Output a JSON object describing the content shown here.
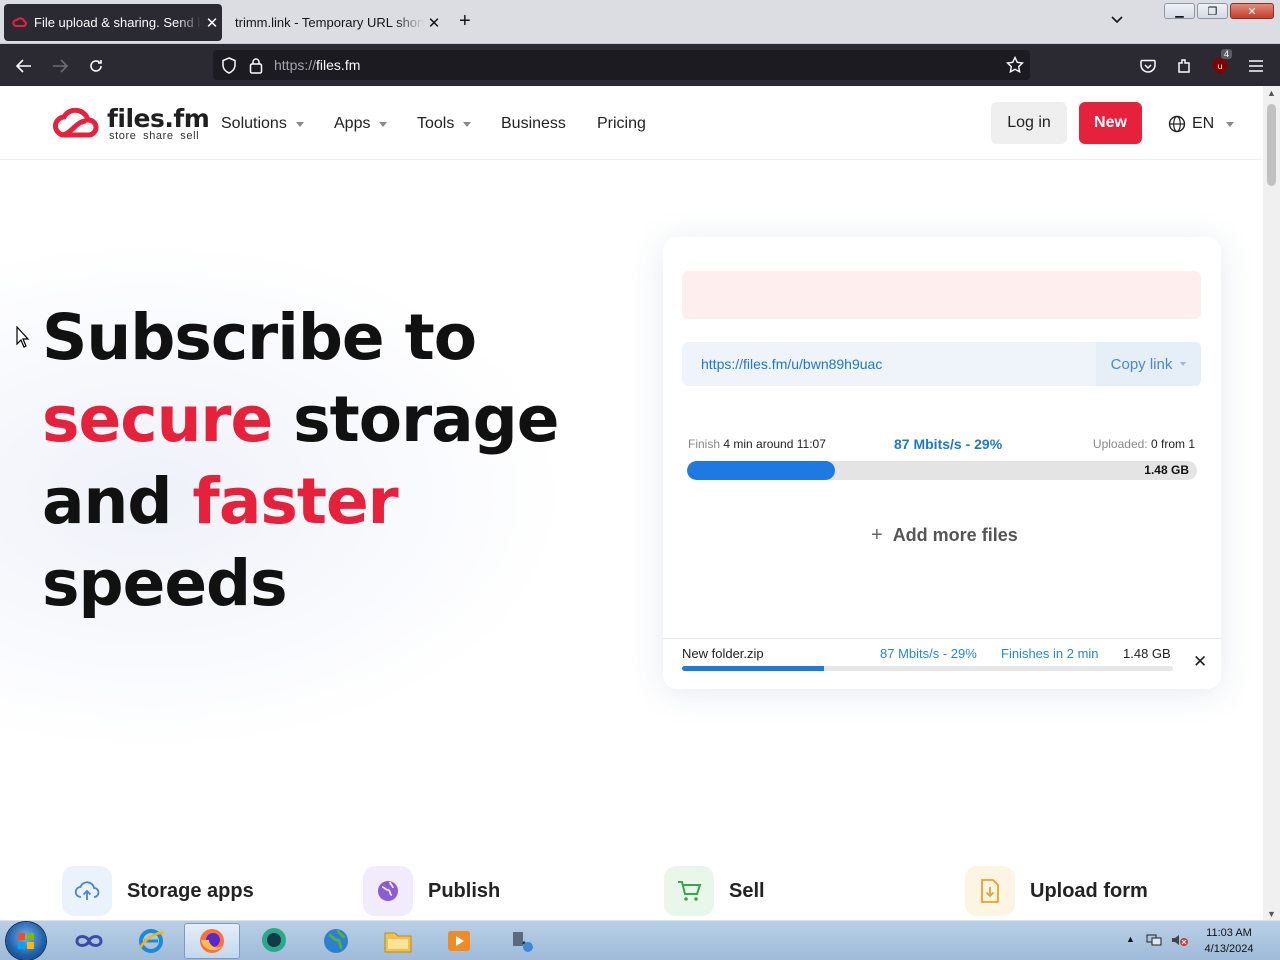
{
  "browser": {
    "tabs": [
      {
        "title": "File upload & sharing. Send large files",
        "active": true
      },
      {
        "title": "trimm.link - Temporary URL shortener",
        "active": false
      }
    ],
    "url_protocol": "https://",
    "url_host": "files.fm",
    "extension_badge": "4"
  },
  "site": {
    "brand": "files.fm",
    "tagline": "store share sell",
    "nav": [
      {
        "label": "Solutions",
        "dropdown": true
      },
      {
        "label": "Apps",
        "dropdown": true
      },
      {
        "label": "Tools",
        "dropdown": true
      },
      {
        "label": "Business",
        "dropdown": false
      },
      {
        "label": "Pricing",
        "dropdown": false
      }
    ],
    "login_label": "Log in",
    "new_label": "New",
    "lang_label": "EN"
  },
  "hero": {
    "line1": "Subscribe to",
    "line2_red": "secure",
    "line2_rest": " storage",
    "line3_start": "and ",
    "line3_red": "faster",
    "line4": "speeds"
  },
  "upload": {
    "link_url": "https://files.fm/u/bwn89h9uac",
    "copy_label": "Copy link",
    "finish_label": "Finish",
    "finish_value": "4 min around 11:07",
    "speed": "87 Mbits/s - 29%",
    "uploaded_label": "Uploaded:",
    "uploaded_value": "0 from 1",
    "total_size": "1.48 GB",
    "progress_fraction": 0.29,
    "add_more_label": "Add more files",
    "file": {
      "name": "New folder.zip",
      "speed": "87 Mbits/s - 29%",
      "finishes": "Finishes in 2 min",
      "size": "1.48 GB",
      "progress_fraction": 0.29
    }
  },
  "features": [
    {
      "label": "Storage apps",
      "icon": "cloud-upload-icon",
      "color": "#eaf2fc"
    },
    {
      "label": "Publish",
      "icon": "globe-icon",
      "color": "#f1ebfb"
    },
    {
      "label": "Sell",
      "icon": "cart-icon",
      "color": "#e8f7ea"
    },
    {
      "label": "Upload form",
      "icon": "file-download-icon",
      "color": "#fdf5e4"
    }
  ],
  "taskbar": {
    "time": "11:03 AM",
    "date": "4/13/2024"
  },
  "colors": {
    "accent_red": "#e5213b",
    "accent_blue": "#1e7ae0",
    "browser_dark": "#2b2a33"
  }
}
